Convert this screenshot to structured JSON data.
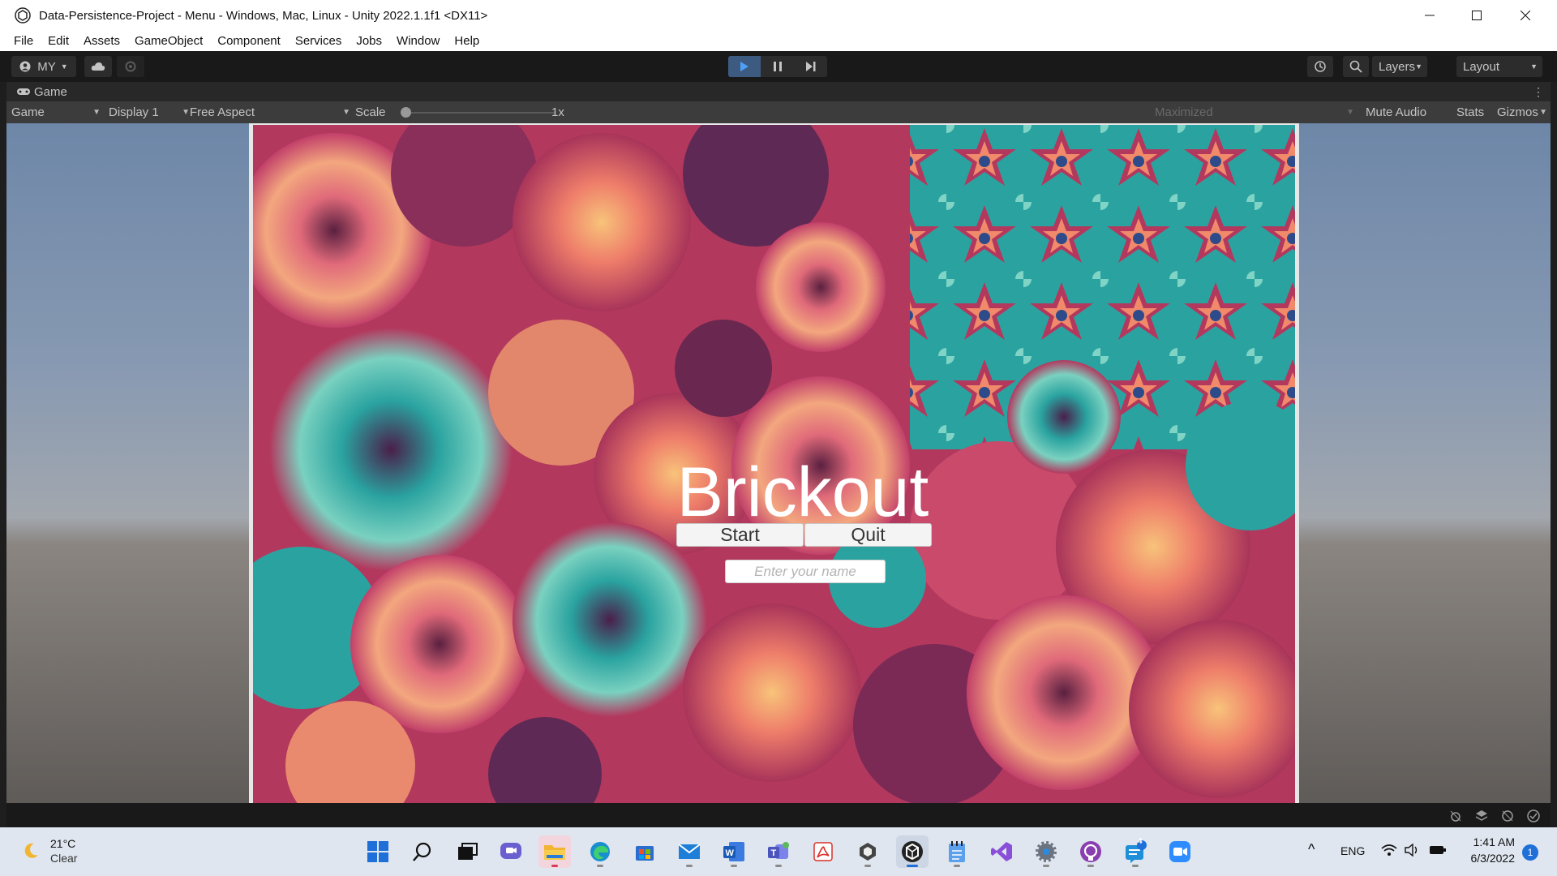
{
  "window": {
    "title": "Data-Persistence-Project - Menu - Windows, Mac, Linux - Unity 2022.1.1f1 <DX11>"
  },
  "menu": [
    "File",
    "Edit",
    "Assets",
    "GameObject",
    "Component",
    "Services",
    "Jobs",
    "Window",
    "Help"
  ],
  "toolbar": {
    "account_label": "MY",
    "layers_label": "Layers",
    "layout_label": "Layout"
  },
  "game_tab": {
    "label": "Game"
  },
  "game_toolbar": {
    "view_mode": "Game",
    "display": "Display 1",
    "aspect": "Free Aspect",
    "scale_label": "Scale",
    "scale_value": "1x",
    "play_mode": "Maximized",
    "mute_audio": "Mute Audio",
    "stats": "Stats",
    "gizmos": "Gizmos"
  },
  "game_ui": {
    "title": "Brickout",
    "start_label": "Start",
    "quit_label": "Quit",
    "name_placeholder": "Enter your name"
  },
  "taskbar": {
    "weather_temp": "21°C",
    "weather_condition": "Clear",
    "language": "ENG",
    "time": "1:41 AM",
    "date": "6/3/2022",
    "notification_count": "1",
    "badge_count": "4",
    "apps": [
      "windows-start",
      "search",
      "task-view",
      "teams-chat",
      "file-explorer",
      "edge",
      "microsoft-store",
      "mail",
      "word",
      "teams",
      "acrobat",
      "unity-hub",
      "unity",
      "notepad",
      "visual-studio",
      "settings",
      "github-desktop",
      "messaging",
      "zoom"
    ]
  },
  "colors": {
    "unity_dark": "#191919",
    "game_bg_pink": "#b3385e",
    "accent_teal": "#2aa3a0",
    "play_blue": "#4e9ff7"
  }
}
